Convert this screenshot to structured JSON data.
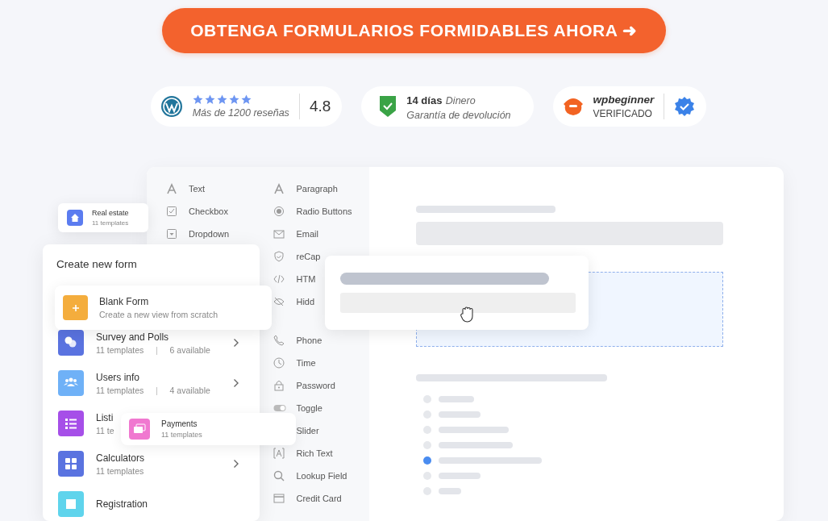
{
  "cta_button": {
    "label": "OBTENGA FORMULARIOS FORMIDABLES AHORA ➜"
  },
  "badges": [
    {
      "kind": "rating",
      "stars": 5,
      "caption": "Más de 1200 reseñas",
      "score": "4.8"
    },
    {
      "kind": "guarantee",
      "title": "14 días",
      "note": "Dinero",
      "caption": "Garantía de devolución"
    },
    {
      "kind": "verified",
      "title": "wpbeginner",
      "caption": "VERIFICADO"
    }
  ],
  "field_palette": {
    "column_1": [
      {
        "kind": "letter",
        "label": "Text"
      },
      {
        "kind": "checkbox",
        "label": "Checkbox"
      },
      {
        "kind": "dropdown",
        "label": "Dropdown"
      }
    ],
    "column_2": [
      {
        "kind": "letter",
        "label": "Paragraph"
      },
      {
        "kind": "radio",
        "label": "Radio Buttons"
      },
      {
        "kind": "mail",
        "label": "Email"
      },
      {
        "kind": "shield",
        "label": "reCap"
      },
      {
        "kind": "code",
        "label": "HTM"
      },
      {
        "kind": "hidden",
        "label": "Hidd"
      },
      {
        "kind": "phone",
        "label": "Phone"
      },
      {
        "kind": "clock",
        "label": "Time"
      },
      {
        "kind": "lock",
        "label": "Password"
      },
      {
        "kind": "toggle",
        "label": "Toggle"
      },
      {
        "kind": "covered",
        "label": "Slider"
      },
      {
        "kind": "richtext",
        "label": "Rich Text"
      },
      {
        "kind": "search",
        "label": "Lookup Field"
      },
      {
        "kind": "card",
        "label": "Credit Card"
      }
    ]
  },
  "real_estate_card": {
    "title": "Real estate",
    "subtitle": "11 templates",
    "color": "#5b7cf0"
  },
  "create_form": {
    "title": "Create new form",
    "blank": {
      "title": "Blank Form",
      "subtitle": "Create a new view from scratch",
      "color": "#f4ad3d"
    },
    "categories": [
      {
        "kind": "chat",
        "title": "Survey and Polls",
        "templates": "11 templates",
        "separator": "|",
        "available": "6 available",
        "color": "#5a73e0"
      },
      {
        "kind": "users",
        "title": "Users info",
        "templates": "11 templates",
        "separator": "|",
        "available": "4 available",
        "color": "#6fb1f7"
      },
      {
        "kind": "list",
        "title": "Listi",
        "templates": "11 te",
        "color": "#a64fe8"
      },
      {
        "kind": "calc",
        "title": "Calculators",
        "templates": "11 templates",
        "color": "#5a73e0"
      },
      {
        "kind": "form",
        "title": "Registration",
        "color": "#5fd4ec"
      }
    ]
  },
  "payments_card": {
    "title": "Payments",
    "subtitle": "11 templates",
    "color": "#f078d0"
  },
  "preview": {
    "options": [
      {
        "selected": false
      },
      {
        "selected": false
      },
      {
        "selected": false
      },
      {
        "selected": false
      },
      {
        "selected": true
      },
      {
        "selected": false
      },
      {
        "selected": false
      }
    ]
  }
}
